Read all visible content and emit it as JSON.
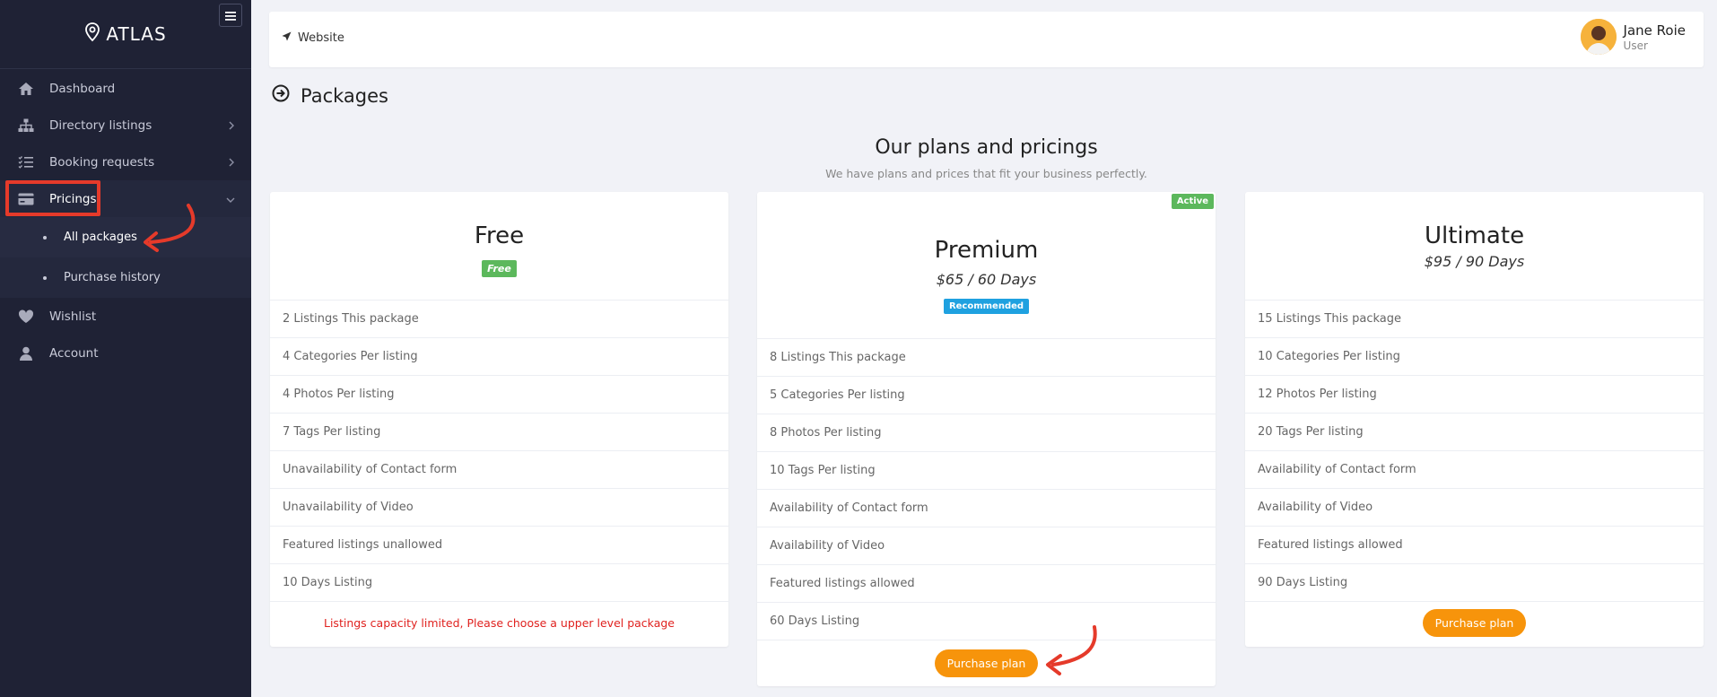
{
  "sidebar": {
    "brand": "ATLAS",
    "items": [
      {
        "label": "Dashboard",
        "icon": "home-icon"
      },
      {
        "label": "Directory listings",
        "icon": "sitemap-icon"
      },
      {
        "label": "Booking requests",
        "icon": "list-check-icon"
      },
      {
        "label": "Pricings",
        "icon": "credit-card-icon"
      },
      {
        "label": "Wishlist",
        "icon": "heart-icon"
      },
      {
        "label": "Account",
        "icon": "user-icon"
      }
    ],
    "pricing_sub": [
      {
        "label": "All packages"
      },
      {
        "label": "Purchase history"
      }
    ]
  },
  "topbar": {
    "website_label": "Website",
    "user_name": "Jane Roie",
    "user_role": "User"
  },
  "page": {
    "title": "Packages",
    "section_title": "Our plans and pricings",
    "section_subtitle": "We have plans and prices that fit your business perfectly."
  },
  "plans": [
    {
      "name": "Free",
      "badge": "Free",
      "features": [
        "2 Listings This package",
        "4 Categories Per listing",
        "4 Photos Per listing",
        "7 Tags Per listing",
        "Unavailability of Contact form",
        "Unavailability of Video",
        "Featured listings unallowed",
        "10 Days Listing"
      ],
      "footer_warning": "Listings capacity limited, Please choose a upper level package"
    },
    {
      "name": "Premium",
      "price": "$65 / 60 Days",
      "badge": "Recommended",
      "status": "Active",
      "features": [
        "8 Listings This package",
        "5 Categories Per listing",
        "8 Photos Per listing",
        "10 Tags Per listing",
        "Availability of Contact form",
        "Availability of Video",
        "Featured listings allowed",
        "60 Days Listing"
      ],
      "button": "Purchase plan"
    },
    {
      "name": "Ultimate",
      "price": "$95 / 90 Days",
      "features": [
        "15 Listings This package",
        "10 Categories Per listing",
        "12 Photos Per listing",
        "20 Tags Per listing",
        "Availability of Contact form",
        "Availability of Video",
        "Featured listings allowed",
        "90 Days Listing"
      ],
      "button": "Purchase plan"
    }
  ],
  "colors": {
    "sidebar_bg": "#1f2235",
    "accent_orange": "#f7940b",
    "success_green": "#5cb85c",
    "info_blue": "#1fa1e0",
    "annotation_red": "#e53a2a"
  }
}
